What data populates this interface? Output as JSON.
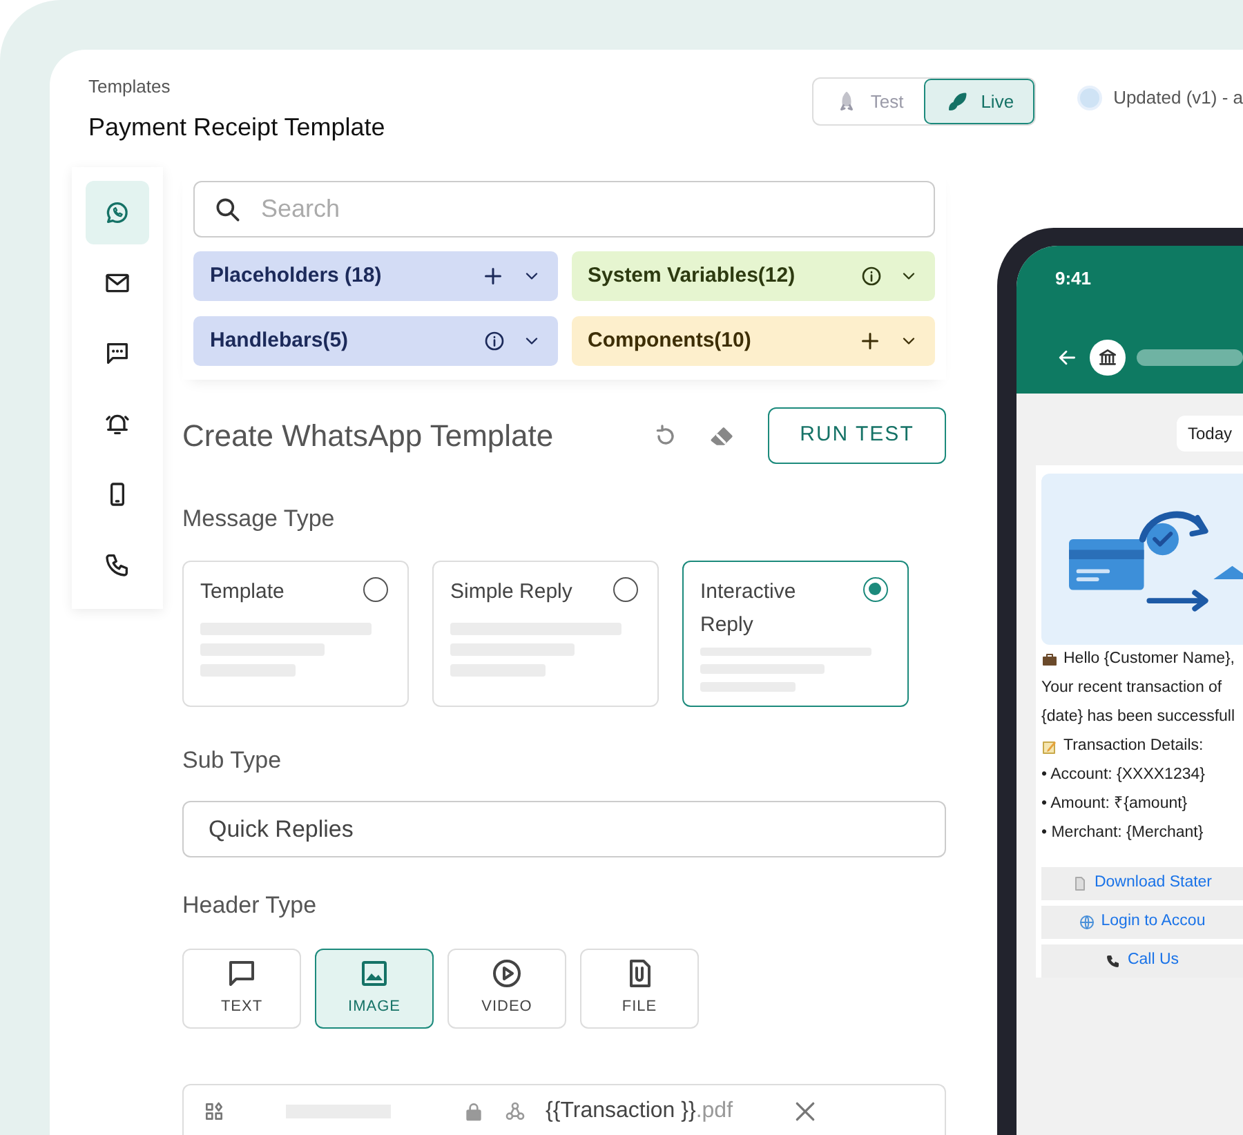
{
  "header": {
    "breadcrumb": "Templates",
    "title": "Payment Receipt Template"
  },
  "mode_toggle": [
    {
      "label": "Test",
      "kind": "test",
      "selected": false
    },
    {
      "label": "Live",
      "kind": "live",
      "selected": true
    }
  ],
  "status": {
    "text": "Updated (v1) - a"
  },
  "sidebar": {
    "items": [
      {
        "kind": "whatsapp",
        "selected": true
      },
      {
        "kind": "mail",
        "selected": false
      },
      {
        "kind": "sms",
        "selected": false
      },
      {
        "kind": "alert",
        "selected": false
      },
      {
        "kind": "mobile",
        "selected": false
      },
      {
        "kind": "call",
        "selected": false
      }
    ]
  },
  "search": {
    "placeholder": "Search"
  },
  "variable_groups": [
    {
      "label": "Placeholders (18)",
      "kind": "add",
      "color": "#d3dcf5"
    },
    {
      "label": "System Variables(12)",
      "kind": "info",
      "color": "#e6f5d0"
    },
    {
      "label": "Handlebars(5)",
      "kind": "info",
      "color": "#d3dcf5"
    },
    {
      "label": "Components(10)",
      "kind": "add",
      "color": "#fdefcc"
    }
  ],
  "editor": {
    "title": "Create WhatsApp Template",
    "run_test": "RUN TEST"
  },
  "message_type": {
    "label": "Message Type",
    "options": [
      {
        "label": "Template",
        "selected": false
      },
      {
        "label": "Simple Reply",
        "selected": false
      },
      {
        "label": "Interactive Reply",
        "selected": true
      }
    ]
  },
  "sub_type": {
    "label": "Sub Type",
    "value": "Quick Replies"
  },
  "header_type": {
    "label": "Header Type",
    "options": [
      {
        "label": "TEXT",
        "kind": "text",
        "selected": false
      },
      {
        "label": "IMAGE",
        "kind": "image",
        "selected": true
      },
      {
        "label": "VIDEO",
        "kind": "video",
        "selected": false
      },
      {
        "label": "FILE",
        "kind": "file",
        "selected": false
      }
    ]
  },
  "attachment": {
    "file_name": "{{Transaction }}",
    "extension": ".pdf"
  },
  "preview": {
    "time": "9:41",
    "date_chip": "Today",
    "message_lines": [
      {
        "kind": "briefcase",
        "text": "Hello {Customer Name},"
      },
      {
        "kind": "plain",
        "text": "Your recent transaction of"
      },
      {
        "kind": "plain",
        "text": "{date} has been successfull"
      },
      {
        "kind": "memo",
        "text": "Transaction Details:"
      },
      {
        "kind": "plain",
        "text": "• Account: {XXXX1234}"
      },
      {
        "kind": "plain",
        "text": "• Amount: ₹{amount}"
      },
      {
        "kind": "plain",
        "text": "• Merchant: {Merchant}"
      }
    ],
    "buttons": [
      {
        "label": "Download Stater",
        "kind": "document"
      },
      {
        "label": "Login to Accou",
        "kind": "web"
      },
      {
        "label": "Call Us",
        "kind": "phone"
      }
    ]
  }
}
